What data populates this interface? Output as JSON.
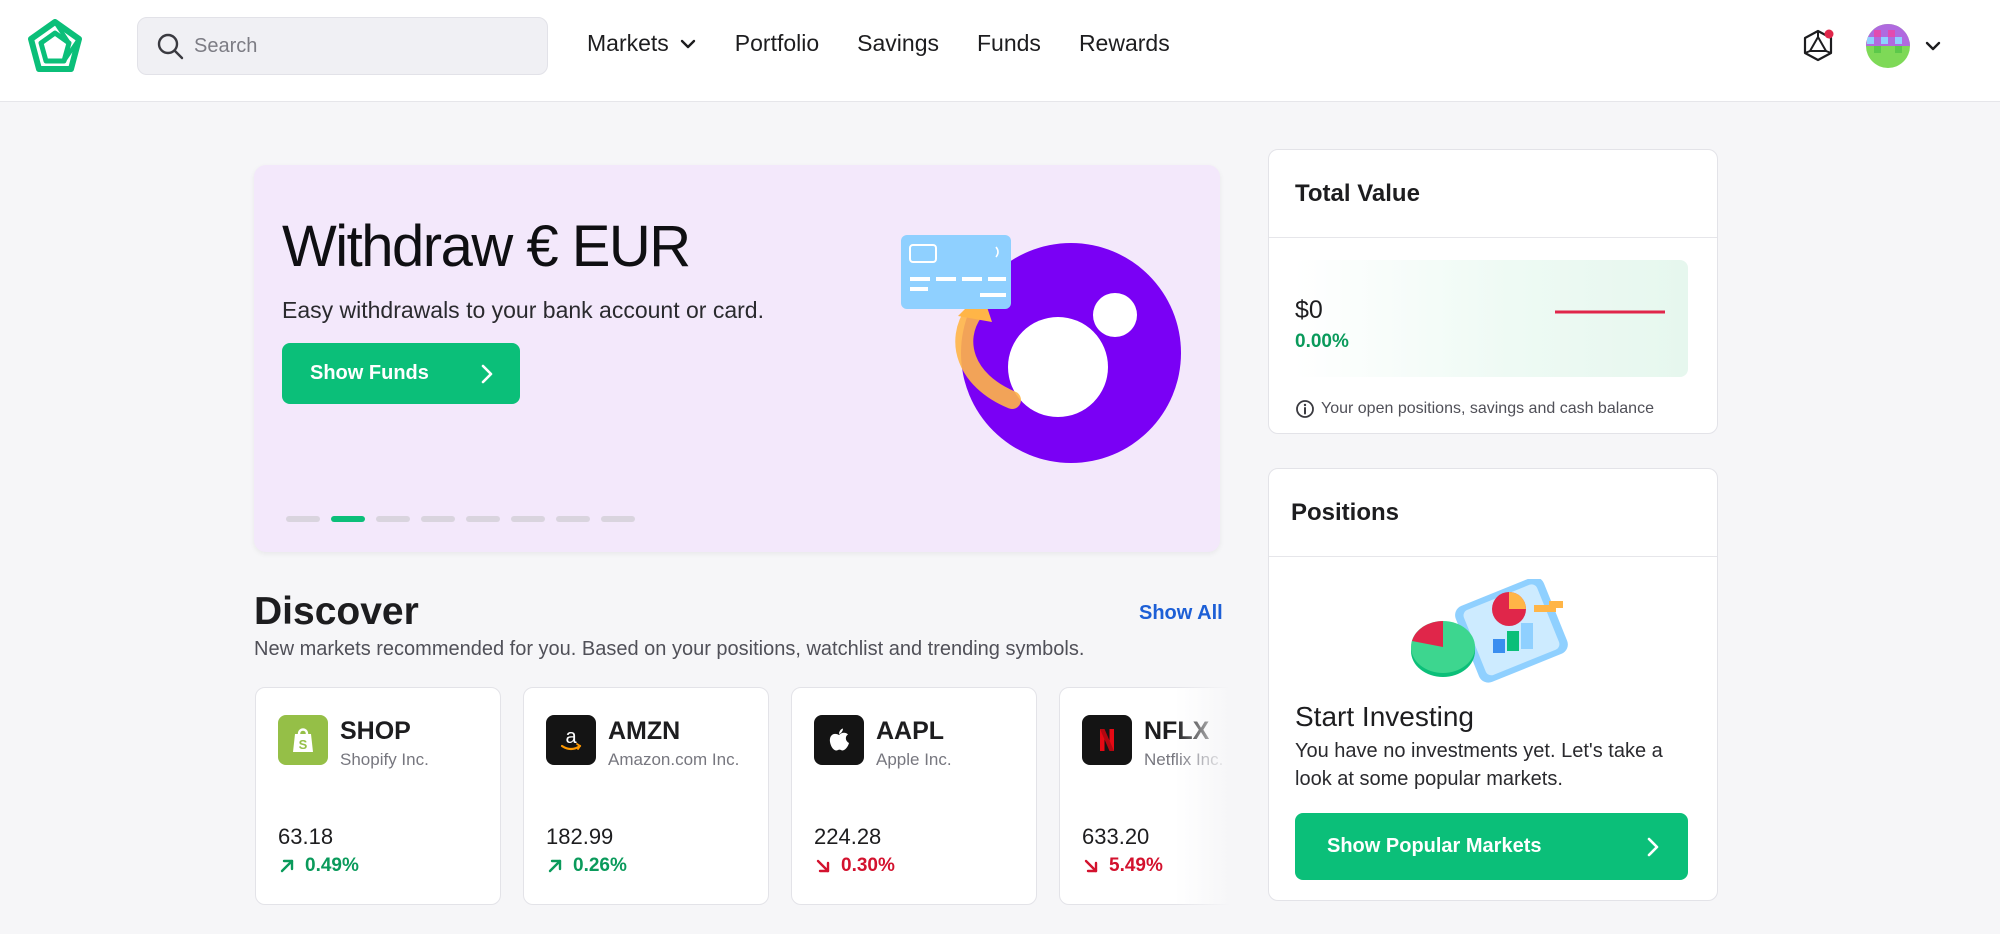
{
  "header": {
    "search": {
      "placeholder": "Search",
      "value": ""
    },
    "nav": [
      {
        "label": "Markets",
        "has_dropdown": true
      },
      {
        "label": "Portfolio"
      },
      {
        "label": "Savings"
      },
      {
        "label": "Funds"
      },
      {
        "label": "Rewards"
      }
    ],
    "icons": [
      "logo-icon",
      "search-icon",
      "ai-assistant-icon",
      "notification-dot",
      "avatar",
      "chevron-down-icon"
    ],
    "accent_color": "#0bbf79"
  },
  "banner": {
    "title": "Withdraw € EUR",
    "subtitle": "Easy withdrawals to your bank account or card.",
    "button_label": "Show Funds",
    "slide_count": 8,
    "active_slide": 2,
    "background_color": "#f3e8fb"
  },
  "discover": {
    "title": "Discover",
    "show_all_label": "Show All",
    "subtitle": "New markets recommended for you. Based on your positions, watchlist and trending symbols.",
    "cards": [
      {
        "ticker": "SHOP",
        "name": "Shopify Inc.",
        "price": "63.18",
        "change": "0.49%",
        "direction": "up",
        "logo_color": "#95bf47"
      },
      {
        "ticker": "AMZN",
        "name": "Amazon.com Inc.",
        "price": "182.99",
        "change": "0.26%",
        "direction": "up",
        "logo_color": "#141414"
      },
      {
        "ticker": "AAPL",
        "name": "Apple Inc.",
        "price": "224.28",
        "change": "0.30%",
        "direction": "down",
        "logo_color": "#141414"
      },
      {
        "ticker": "NFLX",
        "name": "Netflix Inc.",
        "price": "633.20",
        "change": "5.49%",
        "direction": "down",
        "logo_color": "#141414"
      }
    ]
  },
  "total_value": {
    "title": "Total Value",
    "value": "$0",
    "change_pct": "0.00%",
    "info": "Your open positions, savings and cash balance",
    "sparkline_color": "#e0264a"
  },
  "positions": {
    "title": "Positions",
    "heading": "Start Investing",
    "text": "You have no investments yet. Let's take a look at some popular markets.",
    "button_label": "Show Popular Markets"
  },
  "colors": {
    "up": "#0a9a5b",
    "down": "#d3122e",
    "link": "#1d5fd6"
  }
}
